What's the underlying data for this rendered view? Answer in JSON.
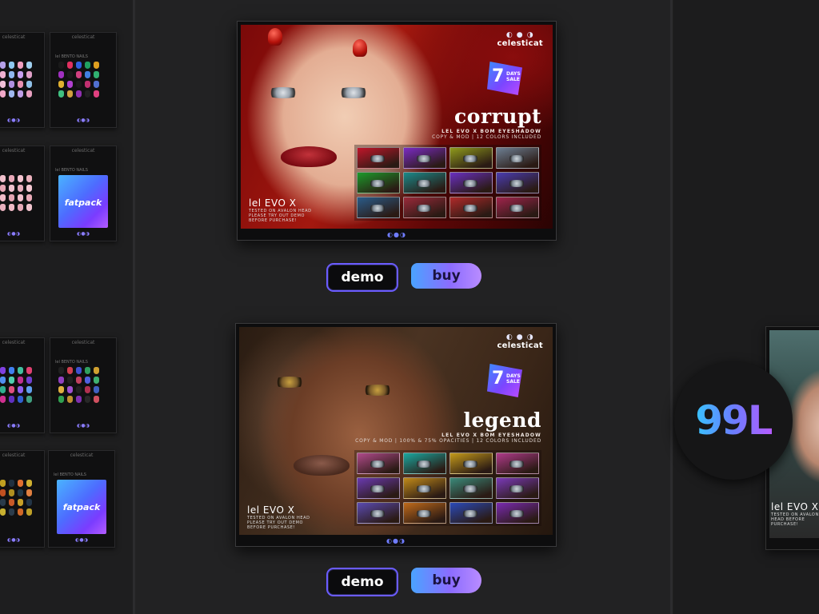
{
  "brand": {
    "name": "celesticat",
    "moons": "◐ ● ◑"
  },
  "posters": [
    {
      "name": "corrupt",
      "subtitle": "LEL EVO X BOM EYESHADOW",
      "subtitle2": "COPY & MOD | 12 COLORS INCLUDED",
      "sale_number": "7",
      "sale_text": "DAYS SALE",
      "head": "lel EVO X",
      "note_lines": [
        "TESTED ON AVALON HEAD",
        "PLEASE TRY OUT DEMO",
        "BEFORE PURCHASE!"
      ],
      "swatch_colors": [
        "#c0162a",
        "#7a2bc4",
        "#8f9a1c",
        "#6d7f93",
        "#1c9a2a",
        "#1a8a8a",
        "#6a2fc0",
        "#4a3cb0",
        "#2a5c8a",
        "#9a2a3a",
        "#b02a2a",
        "#a0244c"
      ]
    },
    {
      "name": "legend",
      "subtitle": "LEL EVO X BOM EYESHADOW",
      "subtitle2": "COPY & MOD | 100% & 75% OPACITIES | 12 COLORS INCLUDED",
      "sale_number": "7",
      "sale_text": "DAYS SALE",
      "head": "lel EVO X",
      "note_lines": [
        "TESTED ON AVALON HEAD",
        "PLEASE TRY OUT DEMO",
        "BEFORE PURCHASE!"
      ],
      "swatch_colors": [
        "#b04a8a",
        "#1aa8a0",
        "#c49a1a",
        "#b03a8a",
        "#6a3ab0",
        "#c08a1a",
        "#3a8a7a",
        "#7a3ab8",
        "#5a4ab0",
        "#c06a1a",
        "#2a4ab8",
        "#7a2ab0"
      ]
    }
  ],
  "buttons": {
    "demo": "demo",
    "buy": "buy"
  },
  "price": "99L",
  "side_poster": {
    "head": "lel EVO X",
    "note": "TESTED ON AVALON HEAD BEFORE PURCHASE!"
  },
  "mini_boxes": [
    {
      "label": "celesticat",
      "kind": "nails",
      "colors": [
        "#e88fb8",
        "#b5a0e8",
        "#8ec8f0",
        "#f0a0c0",
        "#a0d0f0",
        "#d090e0",
        "#f0b0d0",
        "#90b8f0",
        "#c8a0f0",
        "#e0a0c8",
        "#a8c8f0",
        "#f0c0d8",
        "#b090e0",
        "#e890b0",
        "#90c0e8",
        "#d8a8f0",
        "#f0a8c8",
        "#a0b8f0",
        "#c0a0e8",
        "#e8a0c0"
      ]
    },
    {
      "label": "celesticat",
      "sub": "lel BENTO NAILS",
      "kind": "nails",
      "colors": [
        "#1a1a1a",
        "#e03060",
        "#3060e0",
        "#20a060",
        "#e0a020",
        "#a030c0",
        "#1a1a1a",
        "#d04080",
        "#4080e0",
        "#30b070",
        "#e0b030",
        "#b040d0",
        "#1a1a1a",
        "#c03070",
        "#5070d0",
        "#40c080",
        "#d0a040",
        "#9030b0",
        "#202020",
        "#e04080"
      ]
    },
    {
      "label": "celesticat",
      "kind": "nails",
      "colors": [
        "#f0b0c0",
        "#f0c0cc",
        "#e8a8b8",
        "#f4c4d0",
        "#eab0bc",
        "#f2bac6",
        "#e6a6b4",
        "#f0c2ce",
        "#e8aebc",
        "#f4c8d2",
        "#ecb4c0",
        "#f0bcc8",
        "#e4a4b2",
        "#f2c0cc",
        "#eaaab8",
        "#f4c6d0",
        "#e8b0be",
        "#f0bac6",
        "#e6a8b6",
        "#f2c4ce"
      ]
    },
    {
      "label": "celesticat",
      "sub": "lel BENTO NAILS",
      "kind": "fatpack",
      "art_label": "fatpack"
    },
    {
      "label": "celesticat",
      "kind": "nails",
      "colors": [
        "#d040a0",
        "#8040e0",
        "#4080f0",
        "#40c0a0",
        "#e04070",
        "#a050e0",
        "#5090f0",
        "#50d0b0",
        "#c03090",
        "#7040d0",
        "#3070e0",
        "#30b090",
        "#e05080",
        "#9060f0",
        "#60a0f0",
        "#60e0c0",
        "#d03090",
        "#6030c0",
        "#3060d0",
        "#40a080"
      ]
    },
    {
      "label": "celesticat",
      "sub": "lel BENTO NAILS",
      "kind": "nails",
      "colors": [
        "#202020",
        "#d04050",
        "#4050d0",
        "#30a060",
        "#d0a030",
        "#9040c0",
        "#202020",
        "#c04060",
        "#5060e0",
        "#40b070",
        "#e0b040",
        "#a050d0",
        "#202020",
        "#b03050",
        "#4060c0",
        "#30a050",
        "#c09030",
        "#8030b0",
        "#282828",
        "#d05060"
      ]
    },
    {
      "label": "celesticat",
      "kind": "nails",
      "colors": [
        "#d06020",
        "#c0a020",
        "#203040",
        "#e07030",
        "#d0b030",
        "#304050",
        "#c05020",
        "#b09020",
        "#203848",
        "#e08040",
        "#d0a830",
        "#2a3a4a",
        "#c85a28",
        "#c8a028",
        "#223446",
        "#d86a30",
        "#c8b030",
        "#2c3c4c",
        "#d06828",
        "#bfa028"
      ]
    },
    {
      "label": "celesticat",
      "sub": "lel BENTO NAILS",
      "kind": "fatpack",
      "art_label": "fatpack"
    }
  ]
}
